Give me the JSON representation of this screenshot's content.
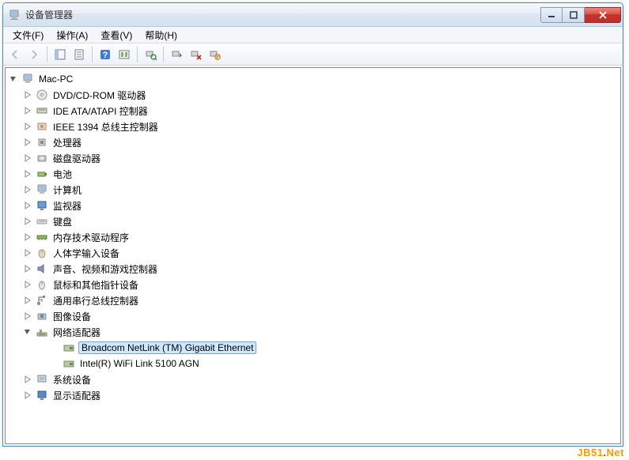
{
  "title": "设备管理器",
  "menu": {
    "file": "文件(F)",
    "action": "操作(A)",
    "view": "查看(V)",
    "help": "帮助(H)"
  },
  "root": "Mac-PC",
  "categories": [
    {
      "label": "DVD/CD-ROM 驱动器",
      "expanded": false,
      "icon": "disc"
    },
    {
      "label": "IDE ATA/ATAPI 控制器",
      "expanded": false,
      "icon": "ide"
    },
    {
      "label": "IEEE 1394 总线主控制器",
      "expanded": false,
      "icon": "1394"
    },
    {
      "label": "处理器",
      "expanded": false,
      "icon": "cpu"
    },
    {
      "label": "磁盘驱动器",
      "expanded": false,
      "icon": "disk"
    },
    {
      "label": "电池",
      "expanded": false,
      "icon": "battery"
    },
    {
      "label": "计算机",
      "expanded": false,
      "icon": "computer"
    },
    {
      "label": "监视器",
      "expanded": false,
      "icon": "monitor"
    },
    {
      "label": "键盘",
      "expanded": false,
      "icon": "keyboard"
    },
    {
      "label": "内存技术驱动程序",
      "expanded": false,
      "icon": "memory"
    },
    {
      "label": "人体学输入设备",
      "expanded": false,
      "icon": "hid"
    },
    {
      "label": "声音、视频和游戏控制器",
      "expanded": false,
      "icon": "sound"
    },
    {
      "label": "鼠标和其他指针设备",
      "expanded": false,
      "icon": "mouse"
    },
    {
      "label": "通用串行总线控制器",
      "expanded": false,
      "icon": "usb"
    },
    {
      "label": "图像设备",
      "expanded": false,
      "icon": "camera"
    },
    {
      "label": "网络适配器",
      "expanded": true,
      "icon": "network",
      "children": [
        {
          "label": "Broadcom NetLink (TM) Gigabit Ethernet",
          "selected": true
        },
        {
          "label": "Intel(R) WiFi Link 5100 AGN",
          "selected": false
        }
      ]
    },
    {
      "label": "系统设备",
      "expanded": false,
      "icon": "system"
    },
    {
      "label": "显示适配器",
      "expanded": false,
      "icon": "display"
    }
  ],
  "watermark": {
    "a": "JB51",
    "b": "Net"
  }
}
